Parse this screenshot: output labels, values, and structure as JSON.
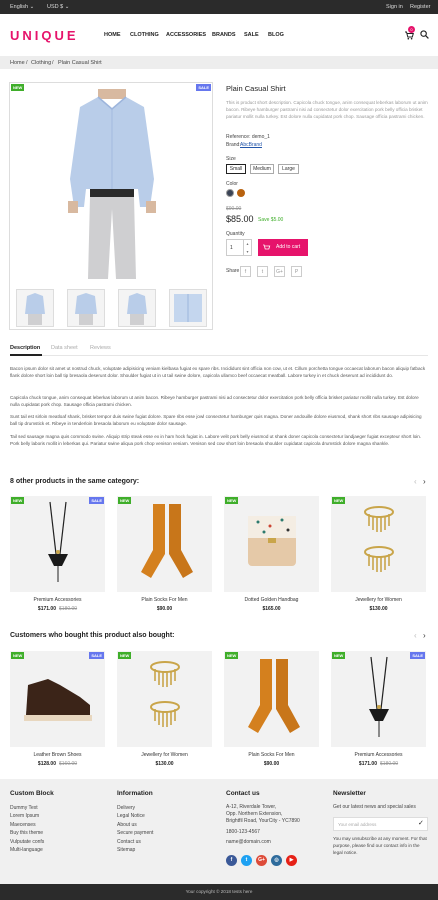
{
  "topbar": {
    "language": "English ⌄",
    "currency": "USD $ ⌄",
    "signin": "Sign in",
    "register": "Register"
  },
  "header": {
    "logo": "UNIQUE",
    "nav": [
      "HOME",
      "CLOTHING",
      "ACCESSORIES",
      "BRANDS",
      "SALE",
      "BLOG"
    ],
    "cart_count": "0"
  },
  "breadcrumb": {
    "home": "Home",
    "sep1": "/",
    "clothing": "Clothing",
    "sep2": "/",
    "current": "Plain Casual Shirt"
  },
  "product": {
    "title": "Plain Casual Shirt",
    "badge_new": "NEW",
    "badge_sale": "SALE",
    "short_desc": "This is product short description. Capicola chuck tongue, anim consequat leberkas laborum ut anim bacon. Ribeye hamburger pastrami nisi ad consectetur dolor exercitation pork belly officia brisket pariatur mollit nulla turkey. Est dolore nulla cupidatat pork chop. Sausage officia pastrami chicken.",
    "reference": "Reference: demo_1",
    "brand_label": "Brand:",
    "brand": "AbcBrand",
    "size_label": "Size",
    "sizes": [
      "Small",
      "Medium",
      "Large"
    ],
    "color_label": "Color",
    "colors": [
      "#3a4456",
      "#b8620e"
    ],
    "old_price": "$90.00",
    "price": "$85.00",
    "save": "Save $5.00",
    "qty_label": "Quantity",
    "qty": "1",
    "add_to_cart": "Add to cart",
    "share_label": "Share",
    "share_icons": [
      "f",
      "t",
      "G+",
      "P"
    ]
  },
  "tabs": [
    "Description",
    "Data sheet",
    "Reviews"
  ],
  "description": [
    "Bacon ipsum dolor sit amet ut nostrud chuck, voluptate adipisicing veniam kielbasa fugiat ex spare ribs. Incididunt sint officia non cow, ut et. Cillum porchetta tongue occaecat laborum bacon aliquip fatback flank dolore short loin ball tip bresaola deserunt dolor. Shoulder fugiat ut in ut tail swine dolore, capicola ullamco beef occaecat meatball. Labore turkey in et chuck deserunt ad incididunt do.",
    "Capicola chuck tongue, anim consequat leberkas laborum ut anim bacon. Ribeye hamburger pastrami nisi ad consectetur dolor exercitation pork belly officia brisket pariatur mollit nulla turkey. Est dolore nulla cupidatat pork chop. Sausage officia pastrami chicken.",
    "Sunt tail est sirloin meatloaf shank, brisket tempor duis swine fugiat dolore. Spare ribs esse jowl consectetur hamburger quis magna. Doner andouille dolore eiusmod, shank short ribs sausage adipisicing ball tip drumstick et. Ribeye in tenderloin bresaola laborum eu voluptate dolor sausage.",
    "Tail sed sausage magna quis commodo swine. Aliquip strip steak esse ex in ham hock fugiat in. Labore velit pork belly eiusmod ut shank doner capicola consectetur landjaeger fugiat excepteur short loin. Pork belly laboris mollit in leberkas qui. Pariatur swine aliqua pork chop venison veniam. Venison sed cow short loin bresaola shoulder cupidatat capicola drumstick dolore magna shankle."
  ],
  "related": {
    "title": "8 other products in the same category:",
    "items": [
      {
        "name": "Premium Accessories",
        "price": "$171.00",
        "old": "$180.00",
        "new": true,
        "sale": true,
        "img": "necklace"
      },
      {
        "name": "Plain Socks For Men",
        "price": "$90.00",
        "old": "",
        "new": true,
        "sale": false,
        "img": "socks"
      },
      {
        "name": "Dotted Golden Handbag",
        "price": "$165.00",
        "old": "",
        "new": true,
        "sale": false,
        "img": "bag"
      },
      {
        "name": "Jewellery for Women",
        "price": "$130.00",
        "old": "",
        "new": true,
        "sale": false,
        "img": "rings"
      }
    ]
  },
  "bought": {
    "title": "Customers who bought this product also bought:",
    "items": [
      {
        "name": "Leather Brown Shoes",
        "price": "$128.00",
        "old": "$160.00",
        "new": true,
        "sale": true,
        "img": "shoe"
      },
      {
        "name": "Jewellery for Women",
        "price": "$130.00",
        "old": "",
        "new": true,
        "sale": false,
        "img": "rings"
      },
      {
        "name": "Plain Socks For Men",
        "price": "$90.00",
        "old": "",
        "new": true,
        "sale": false,
        "img": "socks"
      },
      {
        "name": "Premium Accessories",
        "price": "$171.00",
        "old": "$180.00",
        "new": true,
        "sale": true,
        "img": "necklace"
      }
    ]
  },
  "footer": {
    "custom_title": "Custom Block",
    "custom_items": [
      "Dummy Text",
      "Lorem Ipsum",
      "Maecenses",
      "Buy this theme",
      "Vulputate confs",
      "Multi-language"
    ],
    "info_title": "Information",
    "info_items": [
      "Delivery",
      "Legal Notice",
      "About us",
      "Secure payment",
      "Contact us",
      "Sitemap"
    ],
    "contact_title": "Contact us",
    "contact_lines": [
      "A-12, Riverdale Tower,",
      "Opp. Northern Extension,",
      "Brightfil Road, YourCity - YC7890",
      "1800-123-4567",
      "name@domain.com"
    ],
    "social": [
      {
        "t": "f",
        "c": "#3b5998"
      },
      {
        "t": "t",
        "c": "#1da1f2"
      },
      {
        "t": "G+",
        "c": "#dd4b39"
      },
      {
        "t": "◎",
        "c": "#2e6b9c"
      },
      {
        "t": "▶",
        "c": "#e62117"
      }
    ],
    "news_title": "Newsletter",
    "news_text": "Get our latest news and special sales",
    "news_placeholder": "Your email address",
    "news_note": "You may unsubscribe at any moment. For that purpose, please find our contact info in the legal notice."
  },
  "copyright": "Your copyright © 2018 tests here"
}
